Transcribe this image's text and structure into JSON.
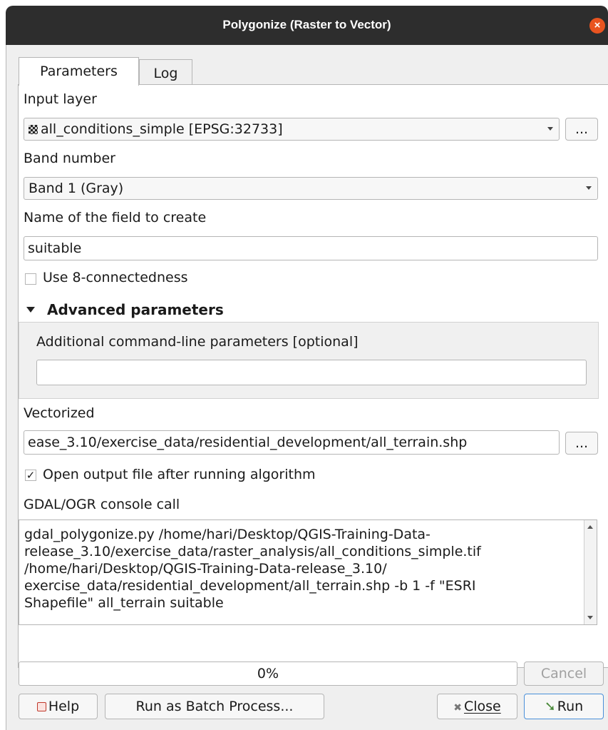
{
  "window": {
    "title": "Polygonize (Raster to Vector)",
    "close_glyph": "×"
  },
  "tabs": [
    {
      "label": "Parameters",
      "active": true
    },
    {
      "label": "Log",
      "active": false
    }
  ],
  "params": {
    "input_layer": {
      "label": "Input layer",
      "value": "all_conditions_simple [EPSG:32733]",
      "icon": "raster-layer-icon",
      "browse_label": "..."
    },
    "band_number": {
      "label": "Band number",
      "value": "Band 1 (Gray)"
    },
    "field_name": {
      "label": "Name of the field to create",
      "value": "suitable"
    },
    "connectedness": {
      "label": "Use 8-connectedness",
      "checked": false
    },
    "advanced": {
      "header": "Advanced parameters",
      "extra_label": "Additional command-line parameters [optional]",
      "extra_value": ""
    },
    "vectorized": {
      "label": "Vectorized",
      "value": "ease_3.10/exercise_data/residential_development/all_terrain.shp",
      "browse_label": "..."
    },
    "open_output": {
      "label": "Open output file after running algorithm",
      "checked": true,
      "check_glyph": "✓"
    },
    "console": {
      "label": "GDAL/OGR console call",
      "lines": [
        "gdal_polygonize.py /home/hari/Desktop/QGIS-Training-Data-",
        "release_3.10/exercise_data/raster_analysis/all_conditions_simple.tif",
        "/home/hari/Desktop/QGIS-Training-Data-release_3.10/",
        "exercise_data/residential_development/all_terrain.shp -b 1 -f \"ESRI",
        "Shapefile\" all_terrain suitable"
      ]
    }
  },
  "progress": {
    "value": 0,
    "text": "0%"
  },
  "buttons": {
    "cancel": "Cancel",
    "help": "Help",
    "batch": "Run as Batch Process...",
    "close": "Close",
    "run": "Run"
  },
  "colors": {
    "titlebar": "#2d2d2d",
    "close_button": "#e95420",
    "disabled_text": "#a0a0a0"
  }
}
